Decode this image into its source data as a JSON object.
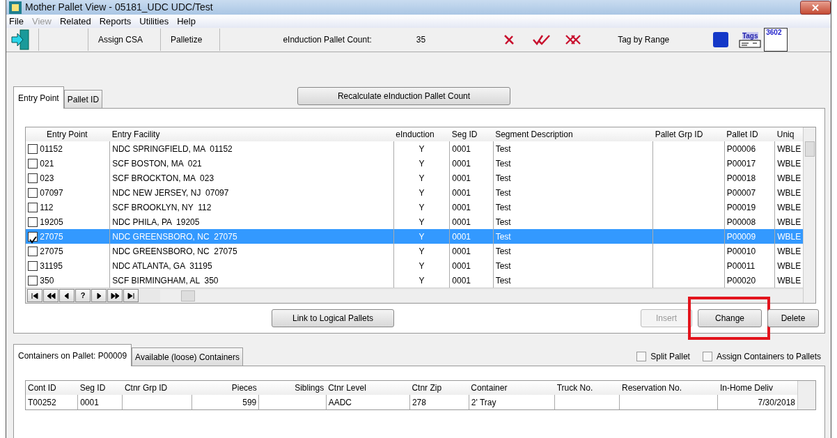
{
  "window": {
    "title": "Mother Pallet View - 05181_UDC UDC/Test"
  },
  "menu": [
    {
      "label": "File",
      "disabled": false
    },
    {
      "label": "View",
      "disabled": true
    },
    {
      "label": "Related",
      "disabled": false
    },
    {
      "label": "Reports",
      "disabled": false
    },
    {
      "label": "Utilities",
      "disabled": false
    },
    {
      "label": "Help",
      "disabled": false
    }
  ],
  "toolbar": {
    "buttons": [
      "Assign CSA",
      "Palletize"
    ],
    "count_label": "eInduction Pallet Count:",
    "count_value": "35",
    "tag_by_range": "Tag by Range",
    "tags_icon_text": "Tags",
    "form_icon_text": "3602"
  },
  "upper_tabs": [
    {
      "label": "Entry Point",
      "selected": true
    },
    {
      "label": "Pallet ID",
      "selected": false
    }
  ],
  "recalculate_button": "Recalculate eInduction Pallet Count",
  "entry_table": {
    "columns": [
      "Entry Point",
      "Entry Facility",
      "eInduction",
      "Seg ID",
      "Segment Description",
      "Pallet Grp ID",
      "Pallet ID",
      "Uniq"
    ],
    "rows": [
      {
        "checked": false,
        "selected": false,
        "cells": [
          "01152",
          "NDC SPRINGFIELD, MA  01152",
          "Y",
          "0001",
          "Test",
          "",
          "P00006",
          "WBLE"
        ]
      },
      {
        "checked": false,
        "selected": false,
        "cells": [
          "021",
          "SCF BOSTON, MA  021",
          "Y",
          "0001",
          "Test",
          "",
          "P00017",
          "WBLE"
        ]
      },
      {
        "checked": false,
        "selected": false,
        "cells": [
          "023",
          "SCF BROCKTON, MA  023",
          "Y",
          "0001",
          "Test",
          "",
          "P00018",
          "WBLE"
        ]
      },
      {
        "checked": false,
        "selected": false,
        "cells": [
          "07097",
          "NDC NEW JERSEY, NJ  07097",
          "Y",
          "0001",
          "Test",
          "",
          "P00007",
          "WBLE"
        ]
      },
      {
        "checked": false,
        "selected": false,
        "cells": [
          "112",
          "SCF BROOKLYN, NY  112",
          "Y",
          "0001",
          "Test",
          "",
          "P00019",
          "WBLE"
        ]
      },
      {
        "checked": false,
        "selected": false,
        "cells": [
          "19205",
          "NDC PHILA, PA  19205",
          "Y",
          "0001",
          "Test",
          "",
          "P00008",
          "WBLE"
        ]
      },
      {
        "checked": true,
        "selected": true,
        "cells": [
          "27075",
          "NDC GREENSBORO, NC  27075",
          "Y",
          "0001",
          "Test",
          "",
          "P00009",
          "WBLE"
        ]
      },
      {
        "checked": false,
        "selected": false,
        "cells": [
          "27075",
          "NDC GREENSBORO, NC  27075",
          "Y",
          "0001",
          "Test",
          "",
          "P00010",
          "WBLE"
        ]
      },
      {
        "checked": false,
        "selected": false,
        "cells": [
          "31195",
          "NDC ATLANTA, GA  31195",
          "Y",
          "0001",
          "Test",
          "",
          "P00011",
          "WBLE"
        ]
      },
      {
        "checked": false,
        "selected": false,
        "cells": [
          "350",
          "SCF BIRMINGHAM, AL  350",
          "Y",
          "0001",
          "Test",
          "",
          "P00020",
          "WBLE"
        ]
      }
    ],
    "navigator": [
      {
        "kind": "first"
      },
      {
        "kind": "prev-page"
      },
      {
        "kind": "prev"
      },
      {
        "kind": "help",
        "label": "?"
      },
      {
        "kind": "next"
      },
      {
        "kind": "next-page"
      },
      {
        "kind": "last"
      }
    ]
  },
  "link_button": "Link to Logical Pallets",
  "action_buttons": [
    {
      "label": "Insert",
      "disabled": true,
      "highlighted": false
    },
    {
      "label": "Change",
      "disabled": false,
      "highlighted": true
    },
    {
      "label": "Delete",
      "disabled": false,
      "highlighted": false
    }
  ],
  "lower_tabs": [
    {
      "label": "Containers on Pallet: P00009",
      "selected": true
    },
    {
      "label": "Available (loose) Containers",
      "selected": false
    }
  ],
  "options": [
    {
      "label": "Split Pallet",
      "checked": false
    },
    {
      "label": "Assign Containers to Pallets",
      "checked": false
    }
  ],
  "container_table": {
    "columns": [
      "Cont ID",
      "Seg ID",
      "Ctnr Grp ID",
      "Pieces",
      "Siblings",
      "Ctnr Level",
      "Ctnr Zip",
      "Container",
      "Truck No.",
      "Reservation No.",
      "In-Home Deliv"
    ],
    "rows": [
      {
        "cells": [
          "T00252",
          "0001",
          "",
          "599",
          "",
          "AADC",
          "278",
          "2' Tray",
          "",
          "",
          "7/30/2018"
        ]
      }
    ]
  }
}
